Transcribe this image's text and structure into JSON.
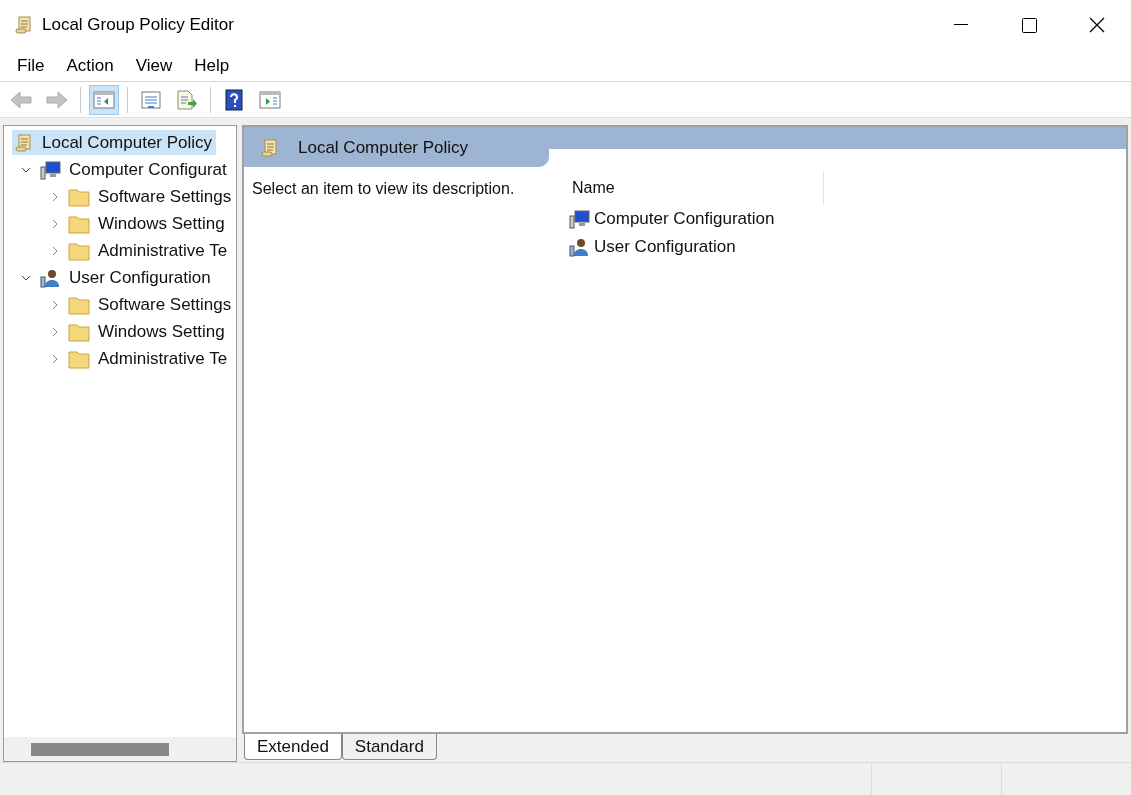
{
  "window": {
    "title": "Local Group Policy Editor"
  },
  "menu": [
    "File",
    "Action",
    "View",
    "Help"
  ],
  "toolbar": [
    {
      "buttons": [
        {
          "kind": "back",
          "disabled": true,
          "pressed": false
        },
        {
          "kind": "forward",
          "disabled": true,
          "pressed": false
        }
      ]
    },
    {
      "buttons": [
        {
          "kind": "tree-pane",
          "disabled": false,
          "pressed": true
        }
      ]
    },
    {
      "buttons": [
        {
          "kind": "properties",
          "disabled": false,
          "pressed": false
        },
        {
          "kind": "export",
          "disabled": false,
          "pressed": false
        }
      ]
    },
    {
      "buttons": [
        {
          "kind": "help",
          "disabled": false,
          "pressed": false
        },
        {
          "kind": "action-pane",
          "disabled": false,
          "pressed": false
        }
      ]
    }
  ],
  "tree": [
    {
      "label": "Local Computer Policy",
      "kind": "scroll",
      "selected": true,
      "expanded": true,
      "children": [
        {
          "label": "Computer Configurat",
          "kind": "computer",
          "selected": false,
          "expanded": true,
          "children": [
            {
              "label": "Software Settings",
              "kind": "folder",
              "selected": false,
              "expanded": false
            },
            {
              "label": "Windows Setting",
              "kind": "folder",
              "selected": false,
              "expanded": false
            },
            {
              "label": "Administrative Te",
              "kind": "folder",
              "selected": false,
              "expanded": false
            }
          ]
        },
        {
          "label": "User Configuration",
          "kind": "user",
          "selected": false,
          "expanded": true,
          "children": [
            {
              "label": "Software Settings",
              "kind": "folder",
              "selected": false,
              "expanded": false
            },
            {
              "label": "Windows Setting",
              "kind": "folder",
              "selected": false,
              "expanded": false
            },
            {
              "label": "Administrative Te",
              "kind": "folder",
              "selected": false,
              "expanded": false
            }
          ]
        }
      ]
    }
  ],
  "details": {
    "header": "Local Computer Policy",
    "description": "Select an item to view its description.",
    "column": "Name",
    "items": [
      {
        "label": "Computer Configuration",
        "kind": "computer"
      },
      {
        "label": "User Configuration",
        "kind": "user"
      }
    ]
  },
  "view_tabs": [
    {
      "label": "Extended",
      "selected": true
    },
    {
      "label": "Standard",
      "selected": false
    }
  ]
}
